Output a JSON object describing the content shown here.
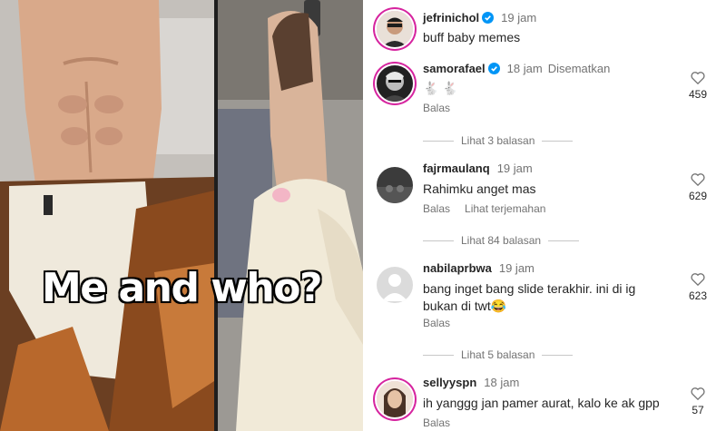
{
  "media": {
    "caption": "Me and who?"
  },
  "caption_comment": {
    "username": "jefrinichol",
    "time": "19 jam",
    "text": "buff baby memes"
  },
  "comments": [
    {
      "username": "samorafael",
      "time": "18 jam",
      "pinned": "Disematkan",
      "text": "🐇 🐇",
      "reply": "Balas",
      "likes": "459",
      "view_replies": "Lihat 3 balasan"
    },
    {
      "username": "fajrmaulanq",
      "time": "19 jam",
      "text": "Rahimku anget mas",
      "reply": "Balas",
      "translate": "Lihat terjemahan",
      "likes": "629",
      "view_replies": "Lihat 84 balasan"
    },
    {
      "username": "nabilaprbwa",
      "time": "19 jam",
      "text_line1": "bang inget bang slide terakhir. ini di ig",
      "text_line2": "bukan di twt😂",
      "reply": "Balas",
      "likes": "623",
      "view_replies": "Lihat 5 balasan"
    },
    {
      "username": "sellyyspn",
      "time": "18 jam",
      "text": "ih yanggg jan pamer aurat, kalo ke ak gpp",
      "reply": "Balas",
      "likes": "57"
    }
  ],
  "colors": {
    "verified": "#0095f6",
    "story_ring": "#d6249f",
    "muted": "#737373"
  },
  "icons": [
    "verified-badge-icon",
    "heart-icon",
    "default-avatar-icon"
  ]
}
